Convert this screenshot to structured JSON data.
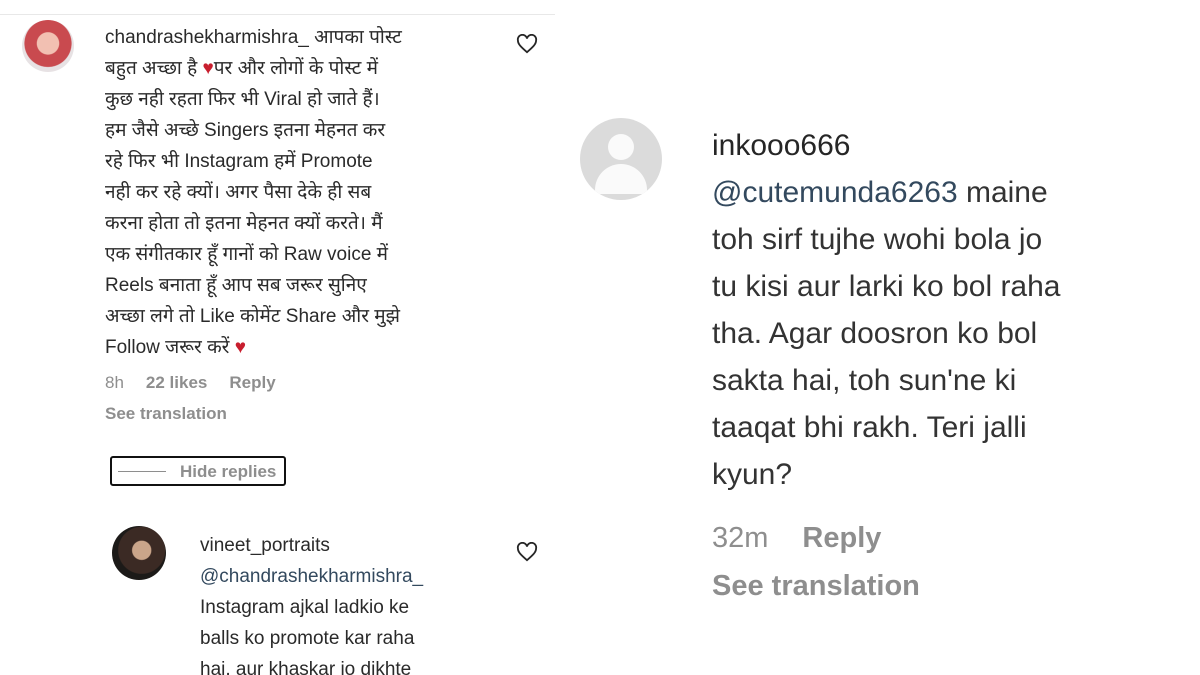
{
  "left_panel": {
    "comment": {
      "username": "chandrashekharmishra_",
      "text_part1": "आपका पोस्ट\nबहुत अच्छा है",
      "heart": "♥",
      "text_part2": "पर और लोगों के पोस्ट में\nकुछ नही रहता फिर भी Viral हो जाते हैं।\nहम जैसे अच्छे Singers इतना मेहनत कर\nरहे फिर भी Instagram हमें Promote\nनही कर रहे क्यों। अगर पैसा देके ही सब\nकरना होता तो इतना मेहनत क्यों करते। मैं\nएक संगीतकार हूँ गानों को Raw voice में\nReels बनाता हूँ आप सब जरूर सुनिए\nअच्छा लगे तो Like कोमेंट Share और मुझे\nFollow जरूर करें",
      "heart_end": "♥",
      "time": "8h",
      "likes": "22 likes",
      "reply": "Reply",
      "see_translation": "See translation",
      "hide_replies": "Hide replies"
    },
    "reply": {
      "username": "vineet_portraits",
      "mention": "@chandrashekharmishra_",
      "text": "Instagram ajkal ladkio ke\nballs ko promote kar raha\nhai, aur khaskar jo dikhte"
    }
  },
  "right_panel": {
    "comment": {
      "username": "inkooo666",
      "mention": "@cutemunda6263",
      "text": " maine\ntoh sirf tujhe wohi bola jo\ntu kisi aur larki ko bol raha\ntha. Agar doosron ko bol\nsakta hai, toh sun'ne ki\ntaaqat bhi rakh. Teri jalli\nkyun?",
      "time": "32m",
      "reply": "Reply",
      "see_translation": "See translation"
    }
  },
  "colors": {
    "heart": "#c81e2e",
    "meta_gray": "#8e8e8e",
    "mention": "#33495e"
  }
}
